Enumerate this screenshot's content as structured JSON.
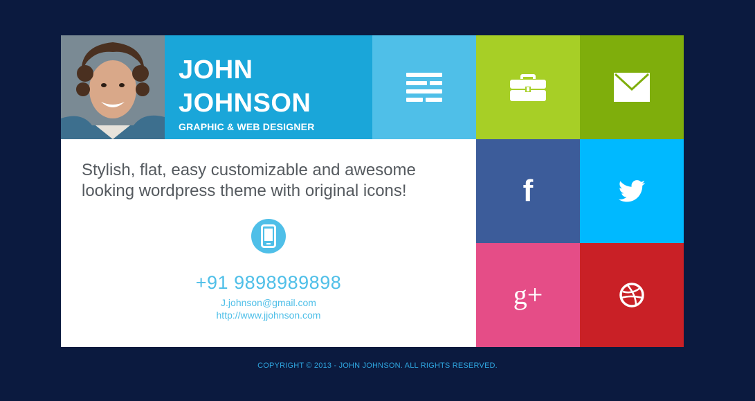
{
  "profile": {
    "first_name": "JOHN",
    "last_name": "JOHNSON",
    "role": "GRAPHIC & WEB DESIGNER"
  },
  "content": {
    "tagline": "Stylish, flat, easy customizable and awesome looking wordpress theme with original icons!",
    "phone": "+91 9898989898",
    "email": "J.johnson@gmail.com",
    "website": "http://www.jjohnson.com"
  },
  "social": {
    "facebook_glyph": "f",
    "googleplus_glyph": "g+"
  },
  "footer": {
    "copyright": "COPYRIGHT © 2013 - JOHN JOHNSON. ALL RIGHTS RESERVED."
  },
  "icons": {
    "menu": "menu-icon",
    "portfolio": "briefcase-icon",
    "contact": "mail-icon",
    "facebook": "facebook-icon",
    "twitter": "twitter-icon",
    "googleplus": "googleplus-icon",
    "dribbble": "dribbble-icon",
    "phone": "smartphone-icon"
  },
  "colors": {
    "background": "#0b1a3f",
    "name_tile": "#1aa6d9",
    "menu_tile": "#4fbfe8",
    "briefcase_tile": "#a7cf26",
    "mail_tile": "#7fae0c",
    "facebook_tile": "#3c5c9a",
    "twitter_tile": "#00b9ff",
    "googleplus_tile": "#e54d87",
    "dribbble_tile": "#c92026",
    "accent_text": "#4fbfe8"
  }
}
